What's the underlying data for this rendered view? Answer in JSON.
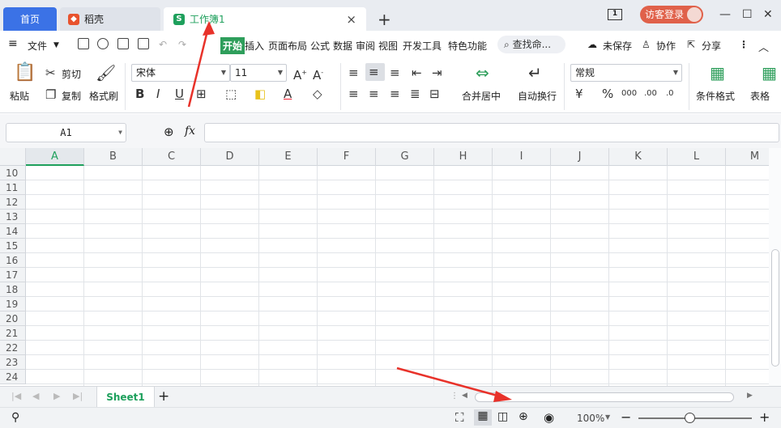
{
  "tabs": {
    "home": "首页",
    "daoke": "稻壳",
    "workbook": "工作簿1",
    "workbook_icon": "S",
    "close": "×",
    "add": "+"
  },
  "titlebar": {
    "window_count": "1",
    "login": "访客登录",
    "minimize": "—",
    "maximize": "☐",
    "close": "✕"
  },
  "menu": {
    "file": "文件",
    "items": [
      "开始",
      "插入",
      "页面布局",
      "公式",
      "数据",
      "审阅",
      "视图",
      "开发工具",
      "特色功能"
    ],
    "search": "查找命...",
    "unsaved": "未保存",
    "collab": "协作",
    "share": "分享"
  },
  "ribbon": {
    "paste": "粘贴",
    "cut": "剪切",
    "copy": "复制",
    "format_painter": "格式刷",
    "font_name": "宋体",
    "font_size": "11",
    "merge_center": "合并居中",
    "wrap_text": "自动换行",
    "number_format": "常规",
    "conditional_format": "条件格式",
    "table_style": "表格"
  },
  "formula_bar": {
    "cell_ref": "A1",
    "fx": "fx",
    "value": ""
  },
  "grid": {
    "columns": [
      "A",
      "B",
      "C",
      "D",
      "E",
      "F",
      "G",
      "H",
      "I",
      "J",
      "K",
      "L",
      "M"
    ],
    "rows": [
      "10",
      "11",
      "12",
      "13",
      "14",
      "15",
      "16",
      "17",
      "18",
      "19",
      "20",
      "21",
      "22",
      "23",
      "24"
    ],
    "selected_column": "A"
  },
  "sheets": {
    "active": "Sheet1",
    "add": "+"
  },
  "status": {
    "zoom": "100%",
    "zoom_level": 0.45,
    "minus": "−",
    "plus": "+"
  },
  "colors": {
    "accent_green": "#1ea05c",
    "home_tab_blue": "#3b72e6",
    "login_red": "#e0614a",
    "annotation_red": "#e8322a"
  }
}
